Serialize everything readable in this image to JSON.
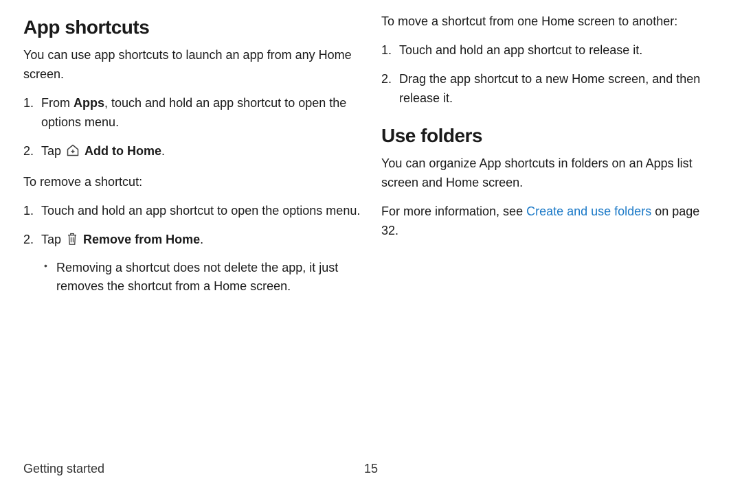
{
  "left": {
    "heading1": "App shortcuts",
    "intro": "You can use app shortcuts to launch an app from any Home screen.",
    "step1_pre": "From ",
    "step1_apps": "Apps",
    "step1_post": ", touch and hold an app shortcut to open the options menu.",
    "step2_tap": "Tap ",
    "step2_label": "Add to Home",
    "step2_period": ".",
    "remove_intro": "To remove a shortcut:",
    "rstep1": "Touch and hold an app shortcut to open the options menu.",
    "rstep2_tap": "Tap ",
    "rstep2_label": "Remove from Home",
    "rstep2_period": ".",
    "bullet1": "Removing a shortcut does not delete the app, it just removes the shortcut from a Home screen."
  },
  "right": {
    "move_intro": "To move a shortcut from one Home screen to another:",
    "mstep1": "Touch and hold an app shortcut to release it.",
    "mstep2": "Drag the app shortcut to a new Home screen, and then release it.",
    "heading2": "Use folders",
    "folders_p": "You can organize App shortcuts in folders on an Apps list screen and Home screen.",
    "more_pre": "For more information, see ",
    "more_link": "Create and use folders",
    "more_post": " on page 32."
  },
  "footer": {
    "section": "Getting started",
    "page": "15"
  }
}
